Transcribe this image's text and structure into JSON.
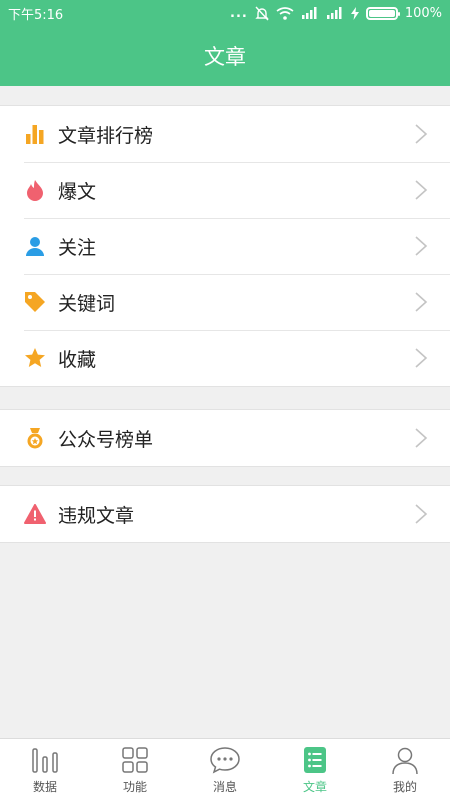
{
  "status": {
    "time": "下午5:16",
    "dots": "...",
    "battery": "100%"
  },
  "header": {
    "title": "文章"
  },
  "groups": {
    "main": [
      {
        "label": "文章排行榜",
        "icon": "bar-chart-icon",
        "color": "#f5a623"
      },
      {
        "label": "爆文",
        "icon": "flame-icon",
        "color": "#f0616f"
      },
      {
        "label": "关注",
        "icon": "person-icon",
        "color": "#2a9de5"
      },
      {
        "label": "关键词",
        "icon": "tag-icon",
        "color": "#f5a623"
      },
      {
        "label": "收藏",
        "icon": "star-icon",
        "color": "#f5a623"
      }
    ],
    "accounts": [
      {
        "label": "公众号榜单",
        "icon": "medal-icon",
        "color": "#f5a623"
      }
    ],
    "violations": [
      {
        "label": "违规文章",
        "icon": "warning-icon",
        "color": "#f0616f"
      }
    ]
  },
  "tabs": [
    {
      "label": "数据",
      "icon": "data-bars-icon",
      "active": false
    },
    {
      "label": "功能",
      "icon": "grid-icon",
      "active": false
    },
    {
      "label": "消息",
      "icon": "chat-bubble-icon",
      "active": false
    },
    {
      "label": "文章",
      "icon": "article-list-icon",
      "active": true
    },
    {
      "label": "我的",
      "icon": "profile-icon",
      "active": false
    }
  ],
  "colors": {
    "brand": "#4cc587",
    "background": "#f0f0f0",
    "text": "#222222"
  }
}
